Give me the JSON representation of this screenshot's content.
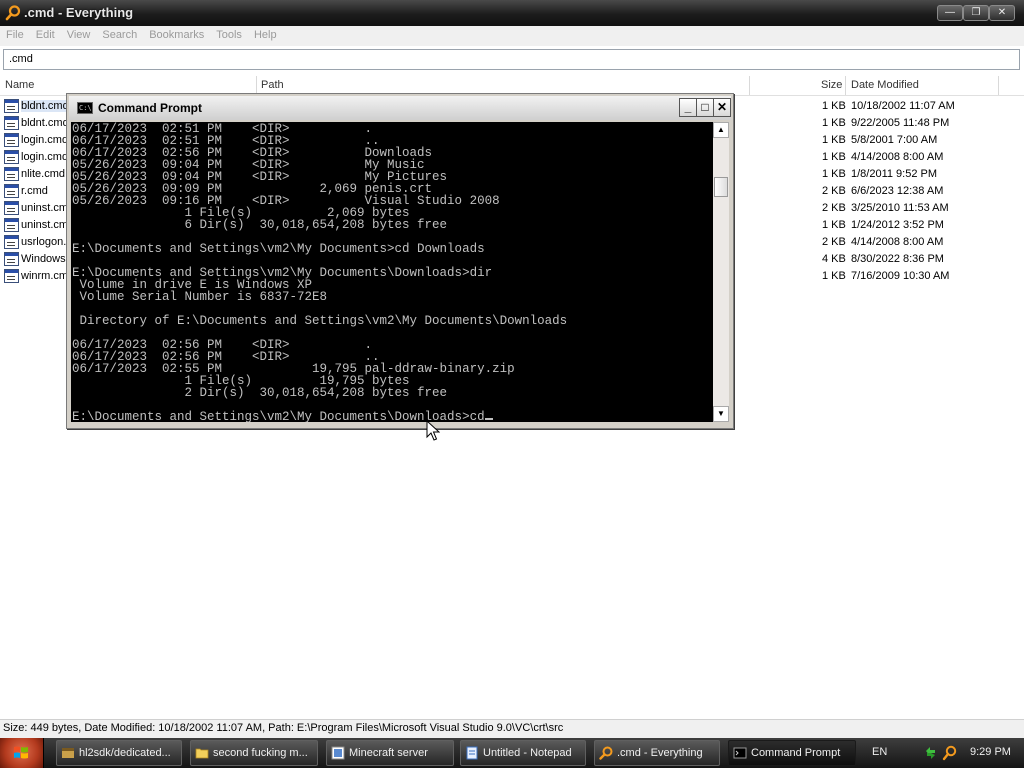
{
  "everything": {
    "title": ".cmd - Everything",
    "menu": [
      "File",
      "Edit",
      "View",
      "Search",
      "Bookmarks",
      "Tools",
      "Help"
    ],
    "search_value": ".cmd",
    "columns": {
      "name": "Name",
      "path": "Path",
      "size": "Size",
      "date": "Date Modified"
    },
    "files": [
      {
        "name": "bldnt.cmd",
        "size": "1 KB",
        "date": "10/18/2002 11:07 AM"
      },
      {
        "name": "bldnt.cmd",
        "size": "1 KB",
        "date": "9/22/2005 11:48 PM"
      },
      {
        "name": "login.cmd",
        "size": "1 KB",
        "date": "5/8/2001 7:00 AM"
      },
      {
        "name": "login.cmd",
        "size": "1 KB",
        "date": "4/14/2008 8:00 AM"
      },
      {
        "name": "nlite.cmd",
        "size": "1 KB",
        "date": "1/8/2011 9:52 PM"
      },
      {
        "name": "r.cmd",
        "size": "2 KB",
        "date": "6/6/2023 12:38 AM"
      },
      {
        "name": "uninst.cmd",
        "size": "2 KB",
        "date": "3/25/2010 11:53 AM"
      },
      {
        "name": "uninst.cmd",
        "size": "1 KB",
        "date": "1/24/2012 3:52 PM"
      },
      {
        "name": "usrlogon.cmd",
        "size": "2 KB",
        "date": "4/14/2008 8:00 AM"
      },
      {
        "name": "Windows",
        "size": "4 KB",
        "date": "8/30/2022 8:36 PM"
      },
      {
        "name": "winrm.cmd",
        "size": "1 KB",
        "date": "7/16/2009 10:30 AM"
      }
    ],
    "status": "Size: 449 bytes, Date Modified: 10/18/2002 11:07 AM, Path: E:\\Program Files\\Microsoft Visual Studio 9.0\\VC\\crt\\src"
  },
  "cmd": {
    "title": "Command Prompt",
    "icon_text": "C:\\",
    "buttons": {
      "minimize": "_",
      "maximize": "□",
      "close": "✕"
    },
    "console_text": "06/17/2023  02:51 PM    <DIR>          .\n06/17/2023  02:51 PM    <DIR>          ..\n06/17/2023  02:56 PM    <DIR>          Downloads\n05/26/2023  09:04 PM    <DIR>          My Music\n05/26/2023  09:04 PM    <DIR>          My Pictures\n05/26/2023  09:09 PM             2,069 penis.crt\n05/26/2023  09:16 PM    <DIR>          Visual Studio 2008\n               1 File(s)          2,069 bytes\n               6 Dir(s)  30,018,654,208 bytes free\n\nE:\\Documents and Settings\\vm2\\My Documents>cd Downloads\n\nE:\\Documents and Settings\\vm2\\My Documents\\Downloads>dir\n Volume in drive E is Windows XP\n Volume Serial Number is 6837-72E8\n\n Directory of E:\\Documents and Settings\\vm2\\My Documents\\Downloads\n\n06/17/2023  02:56 PM    <DIR>          .\n06/17/2023  02:56 PM    <DIR>          ..\n06/17/2023  02:55 PM            19,795 pal-ddraw-binary.zip\n               1 File(s)         19,795 bytes\n               2 Dir(s)  30,018,654,208 bytes free\n\nE:\\Documents and Settings\\vm2\\My Documents\\Downloads>cd"
  },
  "taskbar": {
    "items": [
      {
        "label": "hl2sdk/dedicated..."
      },
      {
        "label": "second fucking m..."
      },
      {
        "label": "Minecraft server"
      },
      {
        "label": "Untitled - Notepad"
      },
      {
        "label": ".cmd - Everything"
      },
      {
        "label": "Command Prompt"
      }
    ],
    "lang": "EN",
    "clock": "9:29 PM"
  },
  "colors": {
    "accent_orange": "#f0a020",
    "console_bg": "#000000",
    "console_fg": "#c0c0c0"
  }
}
